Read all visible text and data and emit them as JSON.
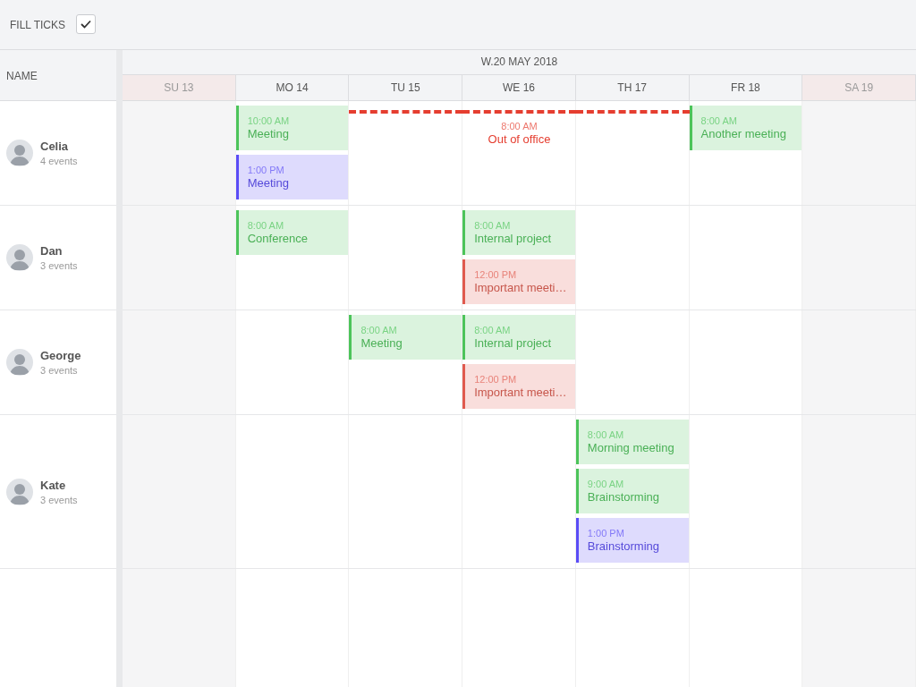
{
  "toolbar": {
    "label": "FILL TICKS",
    "checked": true
  },
  "name_header": "NAME",
  "week_label": "W.20 MAY 2018",
  "days": [
    {
      "label": "SU 13",
      "weekend": true
    },
    {
      "label": "MO 14",
      "weekend": false
    },
    {
      "label": "TU 15",
      "weekend": false
    },
    {
      "label": "WE 16",
      "weekend": false
    },
    {
      "label": "TH 17",
      "weekend": false
    },
    {
      "label": "FR 18",
      "weekend": false
    },
    {
      "label": "SA 19",
      "weekend": true
    }
  ],
  "people": [
    {
      "name": "Celia",
      "count": "4 events",
      "days": [
        {
          "kind": "empty"
        },
        {
          "kind": "slots",
          "items": [
            {
              "kind": "event",
              "time": "10:00 AM",
              "title": "Meeting",
              "color": "#4cc45a"
            },
            {
              "kind": "event",
              "time": "1:00 PM",
              "title": "Meeting",
              "color": "#5a4cf6"
            }
          ]
        },
        {
          "kind": "slots",
          "items": [
            {
              "kind": "absence_line",
              "color": "#e53e30"
            }
          ]
        },
        {
          "kind": "slots",
          "items": [
            {
              "kind": "absence",
              "time": "8:00 AM",
              "title": "Out of office",
              "color": "#e53e30"
            }
          ]
        },
        {
          "kind": "slots",
          "items": [
            {
              "kind": "absence_line",
              "color": "#e53e30"
            }
          ]
        },
        {
          "kind": "slots",
          "items": [
            {
              "kind": "event",
              "time": "8:00 AM",
              "title": "Another meeting",
              "color": "#4cc45a"
            }
          ]
        },
        {
          "kind": "empty"
        }
      ]
    },
    {
      "name": "Dan",
      "count": "3 events",
      "days": [
        {
          "kind": "empty"
        },
        {
          "kind": "slots",
          "items": [
            {
              "kind": "event",
              "time": "8:00 AM",
              "title": "Conference",
              "color": "#4cc45a"
            }
          ]
        },
        {
          "kind": "empty"
        },
        {
          "kind": "slots",
          "items": [
            {
              "kind": "event",
              "time": "8:00 AM",
              "title": "Internal project",
              "color": "#4cc45a"
            },
            {
              "kind": "event",
              "time": "12:00 PM",
              "title": "Important meeti…",
              "color": "#e05a4e"
            }
          ]
        },
        {
          "kind": "empty"
        },
        {
          "kind": "empty"
        },
        {
          "kind": "empty"
        }
      ]
    },
    {
      "name": "George",
      "count": "3 events",
      "days": [
        {
          "kind": "empty"
        },
        {
          "kind": "empty"
        },
        {
          "kind": "slots",
          "items": [
            {
              "kind": "event",
              "time": "8:00 AM",
              "title": "Meeting",
              "color": "#4cc45a"
            }
          ]
        },
        {
          "kind": "slots",
          "items": [
            {
              "kind": "event",
              "time": "8:00 AM",
              "title": "Internal project",
              "color": "#4cc45a"
            },
            {
              "kind": "event",
              "time": "12:00 PM",
              "title": "Important meeti…",
              "color": "#e05a4e"
            }
          ]
        },
        {
          "kind": "empty"
        },
        {
          "kind": "empty"
        },
        {
          "kind": "empty"
        }
      ]
    },
    {
      "name": "Kate",
      "count": "3 events",
      "days": [
        {
          "kind": "empty"
        },
        {
          "kind": "empty"
        },
        {
          "kind": "empty"
        },
        {
          "kind": "empty"
        },
        {
          "kind": "slots",
          "items": [
            {
              "kind": "event",
              "time": "8:00 AM",
              "title": "Morning meeting",
              "color": "#4cc45a"
            },
            {
              "kind": "event",
              "time": "9:00 AM",
              "title": "Brainstorming",
              "color": "#4cc45a"
            },
            {
              "kind": "event",
              "time": "1:00 PM",
              "title": "Brainstorming",
              "color": "#5a4cf6"
            }
          ]
        },
        {
          "kind": "empty"
        },
        {
          "kind": "empty"
        }
      ]
    }
  ]
}
